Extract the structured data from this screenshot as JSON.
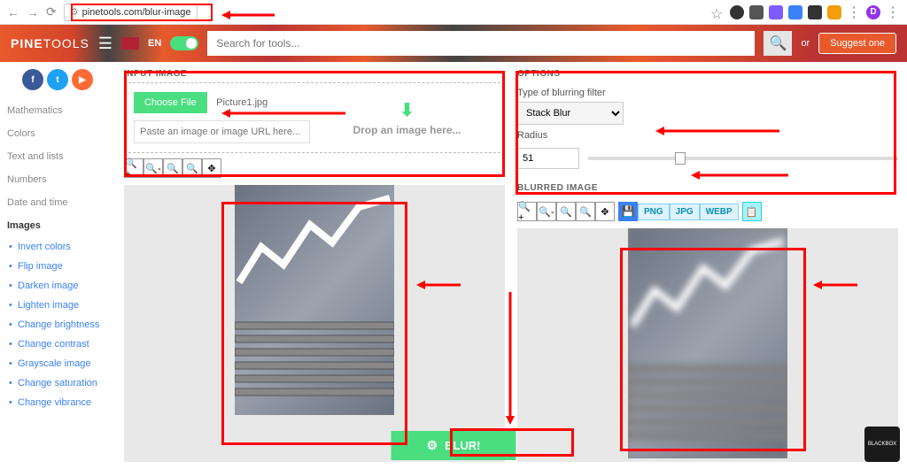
{
  "browser": {
    "url": "pinetools.com/blur-image",
    "profile_letter": "D"
  },
  "header": {
    "logo_part1": "PINE",
    "logo_part2": "TOOLS",
    "lang": "EN",
    "search_placeholder": "Search for tools...",
    "or": "or",
    "suggest": "Suggest one"
  },
  "sidebar": {
    "cats": [
      "Mathematics",
      "Colors",
      "Text and lists",
      "Numbers",
      "Date and time",
      "Images"
    ],
    "subs": [
      "Invert colors",
      "Flip image",
      "Darken image",
      "Lighten image",
      "Change brightness",
      "Change contrast",
      "Grayscale image",
      "Change saturation",
      "Change vibrance"
    ]
  },
  "input_panel": {
    "title": "INPUT IMAGE",
    "choose": "Choose File",
    "filename": "Picture1.jpg",
    "url_placeholder": "Paste an image or image URL here...",
    "drop": "Drop an image here..."
  },
  "options": {
    "title": "OPTIONS",
    "filter_label": "Type of blurring filter",
    "filter_value": "Stack Blur",
    "radius_label": "Radius",
    "radius_value": "51"
  },
  "output": {
    "title": "BLURRED IMAGE",
    "fmt1": "PNG",
    "fmt2": "JPG",
    "fmt3": "WEBP"
  },
  "action_button": "BLUR!",
  "blackbox": "BLACKBOX"
}
